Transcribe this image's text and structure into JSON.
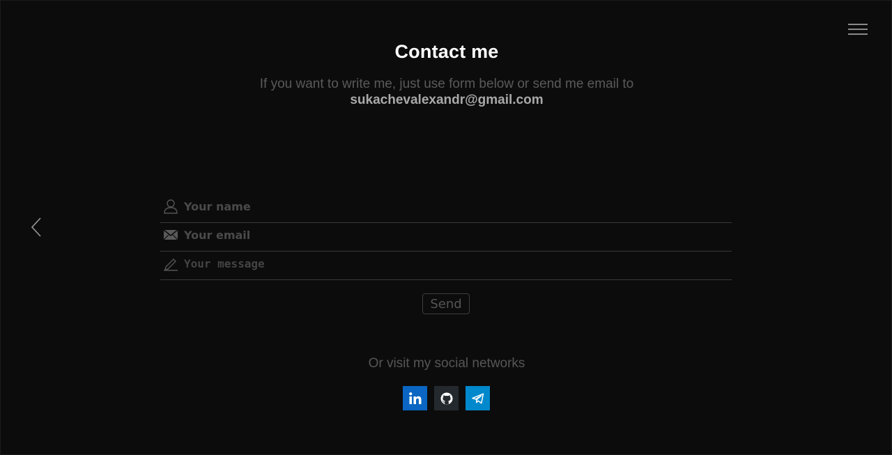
{
  "header": {
    "title": "Contact me",
    "subtitle": "If you want to write me, just use form below or send me email to",
    "email": "sukachevalexandr@gmail.com"
  },
  "nav": {
    "menu_icon": "hamburger-icon",
    "prev_icon": "chevron-left-icon"
  },
  "form": {
    "name_placeholder": "Your name",
    "email_placeholder": "Your email",
    "message_placeholder": "Your message",
    "send_label": "Send"
  },
  "social": {
    "text": "Or visit my social networks",
    "items": [
      {
        "name": "LinkedIn",
        "icon": "linkedin-icon",
        "color": "#0a66c2"
      },
      {
        "name": "GitHub",
        "icon": "github-icon",
        "color": "#24292e"
      },
      {
        "name": "Telegram",
        "icon": "telegram-icon",
        "color": "#0088cc"
      }
    ]
  },
  "colors": {
    "background": "#0c0c0c",
    "title": "#ffffff",
    "muted_text": "#5a5a5a"
  }
}
